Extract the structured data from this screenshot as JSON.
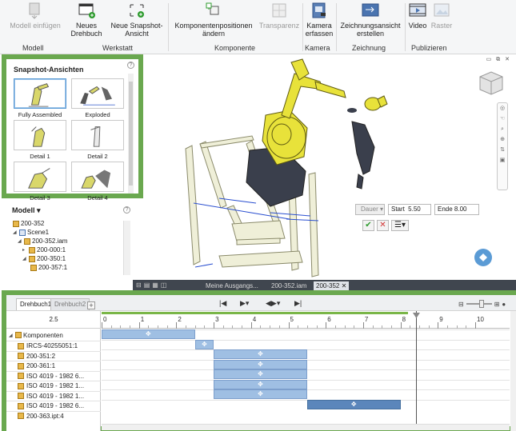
{
  "ribbon": {
    "buttons": [
      {
        "label": "Modell einfügen",
        "icon": "insert-model-icon",
        "enabled": false
      },
      {
        "label": "Neues Drehbuch",
        "icon": "new-storyboard-icon",
        "enabled": true
      },
      {
        "label": "Neue Snapshot-Ansicht",
        "icon": "new-snapshot-icon",
        "enabled": true
      },
      {
        "label": "Komponentenpositionen ändern",
        "icon": "tweak-components-icon",
        "enabled": true
      },
      {
        "label": "Transparenz",
        "icon": "transparency-icon",
        "enabled": false
      },
      {
        "label": "Kamera erfassen",
        "icon": "capture-camera-icon",
        "enabled": true
      },
      {
        "label": "Zeichnungsansicht erstellen",
        "icon": "create-drawing-view-icon",
        "enabled": true
      },
      {
        "label": "Video",
        "icon": "video-icon",
        "enabled": true
      },
      {
        "label": "Raster",
        "icon": "raster-icon",
        "enabled": false
      }
    ],
    "groups": [
      "Modell",
      "Werkstatt",
      "Komponente",
      "Kamera",
      "Zeichnung",
      "Publizieren"
    ]
  },
  "snapshots": {
    "title": "Snapshot-Ansichten",
    "items": [
      "Fully Assembled",
      "Exploded",
      "Detail 1",
      "Detail 2",
      "Detail 3",
      "Detail 4"
    ]
  },
  "model": {
    "title": "Modell",
    "tree": [
      "200-352",
      "Scene1",
      "200-352.iam",
      "200-000:1",
      "200-350:1",
      "200-357:1"
    ]
  },
  "duration": {
    "dropdown": "Dauer",
    "start_label": "Start",
    "start_value": "5.50",
    "end_label": "Ende",
    "end_value": "8.00"
  },
  "doc_tabs": [
    "Meine Ausgangs...",
    "200-352.iam",
    "200-352"
  ],
  "storyboard": {
    "tabs": [
      "Drehbuch1",
      "Drehbuch2"
    ],
    "current_time": "2.5",
    "group_label": "Komponenten",
    "rows": [
      "IRCS-40255051:1",
      "200-351:2",
      "200-361:1",
      "ISO 4019 - 1982 6...",
      "ISO 4019 - 1982 1...",
      "ISO 4019 - 1982 1...",
      "ISO 4019 - 1982 6...",
      "200-363.ipt:4"
    ],
    "ticks": [
      "0",
      "1",
      "2",
      "3",
      "4",
      "5",
      "6",
      "7",
      "8",
      "9",
      "10"
    ],
    "playhead_time": 8.5
  },
  "colors": {
    "highlight_border": "#6aa84f",
    "bar_light": "#9fbfe3",
    "bar_dark": "#5b86bb",
    "robot_yellow": "#e8e23a"
  }
}
